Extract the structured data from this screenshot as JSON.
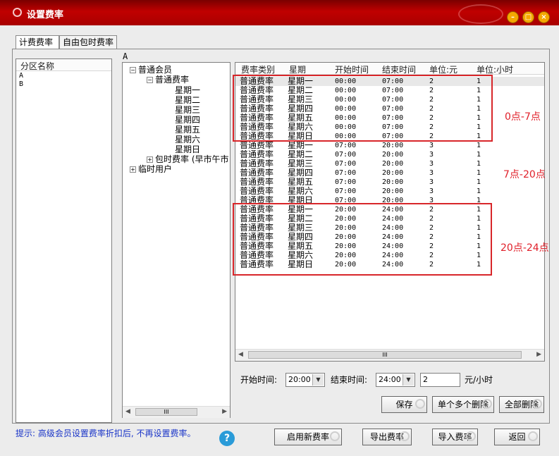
{
  "window": {
    "title": "设置费率"
  },
  "tabs": [
    "计费费率",
    "自由包时费率"
  ],
  "zone_panel": {
    "header": "分区名称",
    "items": [
      "A",
      "B"
    ]
  },
  "selected_zone": "A",
  "tree": {
    "member_normal": "普通会员",
    "rate_normal": "普通费率",
    "days": [
      "星期一",
      "星期二",
      "星期三",
      "星期四",
      "星期五",
      "星期六",
      "星期日"
    ],
    "rate_package": "包时费率 (早市午市",
    "temp_user": "临时用户"
  },
  "table": {
    "headers": [
      "费率类别",
      "星期",
      "开始时间",
      "结束时间",
      "单位:元",
      "单位:小时"
    ],
    "rows": [
      [
        "普通费率",
        "星期一",
        "00:00",
        "07:00",
        "2",
        "1"
      ],
      [
        "普通费率",
        "星期二",
        "00:00",
        "07:00",
        "2",
        "1"
      ],
      [
        "普通费率",
        "星期三",
        "00:00",
        "07:00",
        "2",
        "1"
      ],
      [
        "普通费率",
        "星期四",
        "00:00",
        "07:00",
        "2",
        "1"
      ],
      [
        "普通费率",
        "星期五",
        "00:00",
        "07:00",
        "2",
        "1"
      ],
      [
        "普通费率",
        "星期六",
        "00:00",
        "07:00",
        "2",
        "1"
      ],
      [
        "普通费率",
        "星期日",
        "00:00",
        "07:00",
        "2",
        "1"
      ],
      [
        "普通费率",
        "星期一",
        "07:00",
        "20:00",
        "3",
        "1"
      ],
      [
        "普通费率",
        "星期二",
        "07:00",
        "20:00",
        "3",
        "1"
      ],
      [
        "普通费率",
        "星期三",
        "07:00",
        "20:00",
        "3",
        "1"
      ],
      [
        "普通费率",
        "星期四",
        "07:00",
        "20:00",
        "3",
        "1"
      ],
      [
        "普通费率",
        "星期五",
        "07:00",
        "20:00",
        "3",
        "1"
      ],
      [
        "普通费率",
        "星期六",
        "07:00",
        "20:00",
        "3",
        "1"
      ],
      [
        "普通费率",
        "星期日",
        "07:00",
        "20:00",
        "3",
        "1"
      ],
      [
        "普通费率",
        "星期一",
        "20:00",
        "24:00",
        "2",
        "1"
      ],
      [
        "普通费率",
        "星期二",
        "20:00",
        "24:00",
        "2",
        "1"
      ],
      [
        "普通费率",
        "星期三",
        "20:00",
        "24:00",
        "2",
        "1"
      ],
      [
        "普通费率",
        "星期四",
        "20:00",
        "24:00",
        "2",
        "1"
      ],
      [
        "普通费率",
        "星期五",
        "20:00",
        "24:00",
        "2",
        "1"
      ],
      [
        "普通费率",
        "星期六",
        "20:00",
        "24:00",
        "2",
        "1"
      ],
      [
        "普通费率",
        "星期日",
        "20:00",
        "24:00",
        "2",
        "1"
      ]
    ]
  },
  "annotations": [
    "0点-7点",
    "7点-20点",
    "20点-24点"
  ],
  "editor": {
    "start_label": "开始时间:",
    "start_value": "20:00",
    "end_label": "结束时间:",
    "end_value": "24:00",
    "price_value": "2",
    "unit_label": "元/小时"
  },
  "buttons": {
    "save": "保存",
    "delete_selected": "单个多个删除",
    "delete_all": "全部删除",
    "enable_new": "启用新费率",
    "export": "导出费率",
    "import": "导入费率",
    "back": "返回"
  },
  "hint": "提示: 高级会员设置费率折扣后, 不再设置费率。",
  "scrollbar": {
    "thumb_glyph": "III"
  },
  "colors": {
    "titlebar": "#b40000",
    "annotation_red": "#e0202a",
    "help_blue": "#2a9bd8"
  }
}
